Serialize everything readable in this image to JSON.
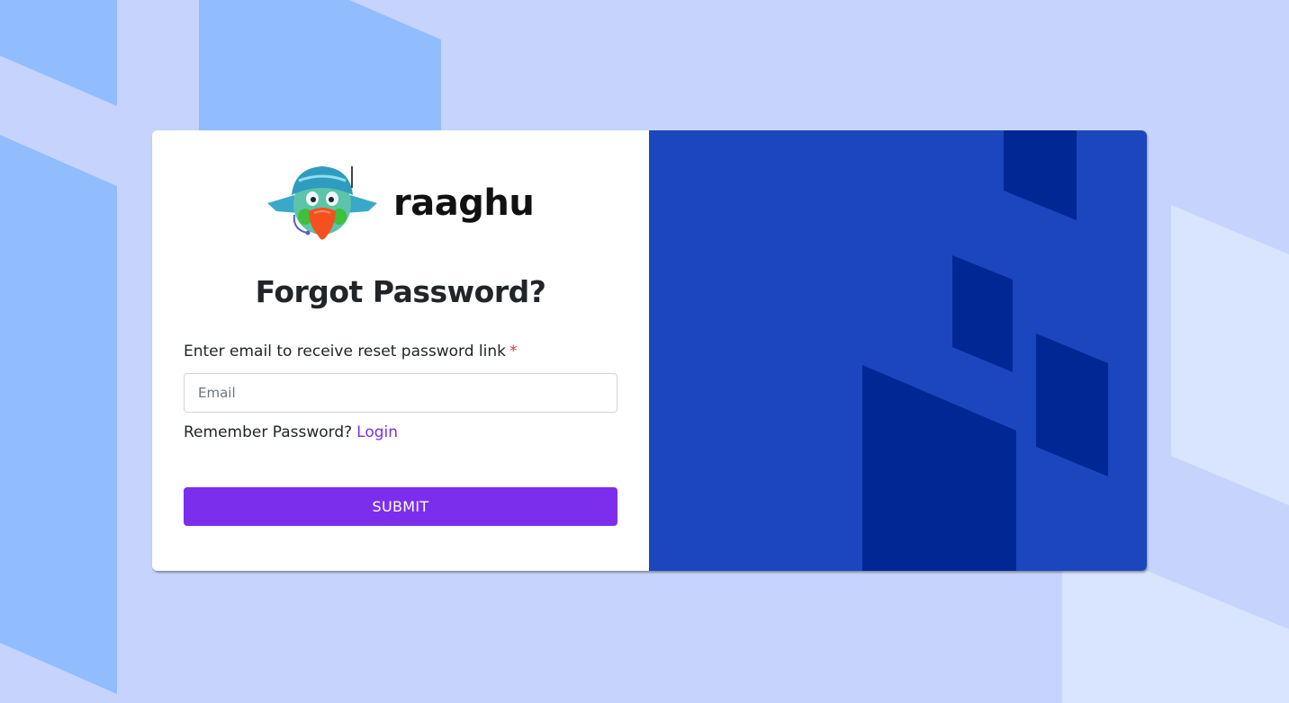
{
  "brand": {
    "name": "raaghu",
    "logo_icon": "parrot-mascot-icon"
  },
  "form": {
    "title": "Forgot Password?",
    "email_label": "Enter email to receive reset password link",
    "required_marker": "*",
    "email_placeholder": "Email",
    "email_value": "",
    "remember_text": "Remember Password?",
    "login_link": "Login",
    "submit_label": "SUBMIT"
  },
  "colors": {
    "page_background": "#c6d4fd",
    "panel_blue": "#1c46bd",
    "panel_dark_blue": "#002794",
    "accent_purple": "#7b2fed",
    "link_purple": "#7b30e8",
    "required_red": "#dc3545"
  }
}
